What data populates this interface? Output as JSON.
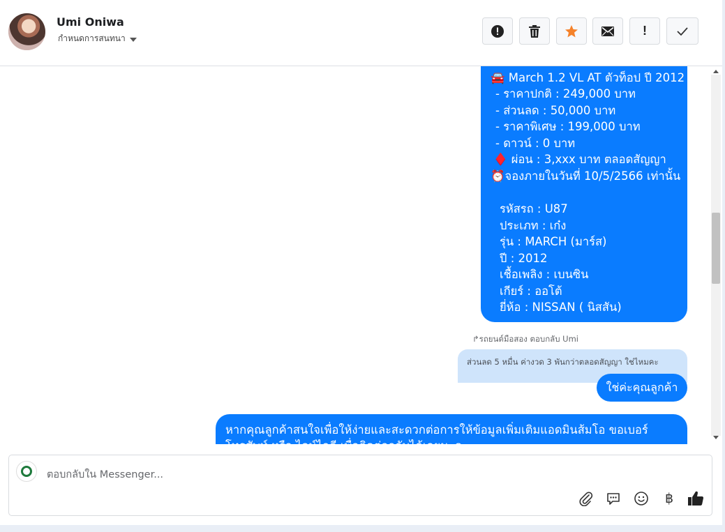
{
  "header": {
    "user_name": "Umi Oniwa",
    "assign_label": "กำหนดการสนทนา",
    "toolbar": [
      "alert-circle-icon",
      "trash-icon",
      "star-icon",
      "envelope-icon",
      "exclamation-icon",
      "check-icon"
    ],
    "colors": {
      "star": "#f5822a"
    }
  },
  "messages": {
    "car_details": [
      "🚘 March 1.2 VL AT ตัวท็อป ปี 2012",
      "-  ราคาปกติ : 249,000 บาท",
      "-  ส่วนลด : 50,000 บาท",
      "-  ราคาพิเศษ : 199,000 บาท",
      "-  ดาวน์ : 0 บาท",
      "♦️ ผ่อน : 3,xxx บาท ตลอดสัญญา",
      "⏰จองภายในวันที่ 10/5/2566 เท่านั้น",
      "",
      "รหัสรถ : U87",
      "ประเภท : เก๋ง",
      "รุ่น : MARCH (มาร์ส)",
      "ปี : 2012",
      "เชื้อเพลิง : เบนซิน",
      "เกียร์ : ออโต้",
      "ยี่ห้อ : NISSAN ( นิสสัน)"
    ],
    "reply_hint": "รถยนต์มือสอง ตอบกลับ Umi",
    "quoted": "ส่วนลด 5 หมื่น ค่างวด 3 พันกว่าตลอดสัญญา ใช่ไหมคะ",
    "reply": "ใช่ค่ะคุณลูกค้า",
    "followup_line1": "หากคุณลูกค้าสนใจเพื่อให้ง่ายและสะดวกต่อการให้ข้อมูลเพิ่มเติมแอดมินส้มโอ ขอเบอร์",
    "followup_line2": "โทรศัพท์ หรือ ไลน์ไอดี เพื่อติดต่อกลับได้เลยนะคะ"
  },
  "composer": {
    "placeholder": "ตอบกลับใน Messenger...",
    "icons": [
      "paperclip-icon",
      "chat-bubble-icon",
      "emoji-icon",
      "baht-icon",
      "thumbs-up-icon"
    ],
    "baht_symbol": "฿"
  },
  "colors": {
    "bubble": "#0a7cff",
    "quoted": "#cfe4fb"
  }
}
